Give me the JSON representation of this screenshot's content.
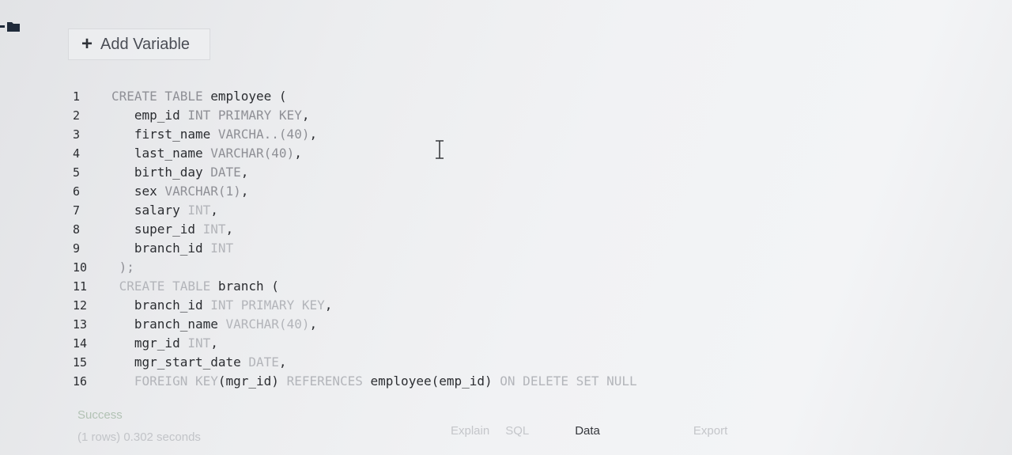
{
  "toolbar": {
    "add_variable_label": "Add Variable"
  },
  "editor": {
    "line_numbers": [
      "1",
      "2",
      "3",
      "4",
      "5",
      "6",
      "7",
      "8",
      "9",
      "10",
      "11",
      "12",
      "13",
      "14",
      "15",
      "16"
    ],
    "lines": [
      [
        {
          "t": "CREATE TABLE",
          "c": "kw"
        },
        {
          "t": " employee (",
          "c": "ident"
        }
      ],
      [
        {
          "t": "   emp_id ",
          "c": "ident"
        },
        {
          "t": "INT PRIMARY KEY",
          "c": "kw"
        },
        {
          "t": ",",
          "c": "punct"
        }
      ],
      [
        {
          "t": "   first_name ",
          "c": "ident"
        },
        {
          "t": "VARCHA..(40)",
          "c": "kw"
        },
        {
          "t": ",",
          "c": "punct"
        }
      ],
      [
        {
          "t": "   last_name ",
          "c": "ident"
        },
        {
          "t": "VARCHAR(40)",
          "c": "kw"
        },
        {
          "t": ",",
          "c": "punct"
        }
      ],
      [
        {
          "t": "   birth_day ",
          "c": "ident"
        },
        {
          "t": "DATE",
          "c": "kw"
        },
        {
          "t": ",",
          "c": "punct"
        }
      ],
      [
        {
          "t": "   sex ",
          "c": "ident"
        },
        {
          "t": "VARCHAR(1)",
          "c": "kw"
        },
        {
          "t": ",",
          "c": "punct"
        }
      ],
      [
        {
          "t": "   salary ",
          "c": "ident"
        },
        {
          "t": "INT",
          "c": "kw-faint"
        },
        {
          "t": ",",
          "c": "punct"
        }
      ],
      [
        {
          "t": "   super_id ",
          "c": "ident"
        },
        {
          "t": "INT",
          "c": "kw-faint"
        },
        {
          "t": ",",
          "c": "punct"
        }
      ],
      [
        {
          "t": "   branch_id ",
          "c": "ident"
        },
        {
          "t": "INT",
          "c": "kw-faint"
        }
      ],
      [
        {
          "t": " );",
          "c": "kw"
        }
      ],
      [
        {
          "t": " CREATE TABLE",
          "c": "kw-faint"
        },
        {
          "t": " branch (",
          "c": "ident"
        }
      ],
      [
        {
          "t": "   branch_id ",
          "c": "ident"
        },
        {
          "t": "INT PRIMARY KEY",
          "c": "kw-faint"
        },
        {
          "t": ",",
          "c": "punct"
        }
      ],
      [
        {
          "t": "   branch_name ",
          "c": "ident"
        },
        {
          "t": "VARCHAR(40)",
          "c": "kw-faint"
        },
        {
          "t": ",",
          "c": "punct"
        }
      ],
      [
        {
          "t": "   mgr_id ",
          "c": "ident"
        },
        {
          "t": "INT",
          "c": "kw-faint"
        },
        {
          "t": ",",
          "c": "punct"
        }
      ],
      [
        {
          "t": "   mgr_start_date ",
          "c": "ident"
        },
        {
          "t": "DATE",
          "c": "kw-faint"
        },
        {
          "t": ",",
          "c": "punct"
        }
      ],
      [
        {
          "t": "   FOREIGN KEY",
          "c": "kw-faint"
        },
        {
          "t": "(mgr_id) ",
          "c": "ident"
        },
        {
          "t": "REFERENCES",
          "c": "kw-faint"
        },
        {
          "t": " employee(emp_id) ",
          "c": "ident"
        },
        {
          "t": "ON DELETE SET NULL",
          "c": "kw-faint"
        }
      ]
    ]
  },
  "status": {
    "result": "Success",
    "meta": "(1 rows) 0.302 seconds"
  },
  "result_tabs": {
    "explain": "Explain",
    "sql": "SQL",
    "data": "Data",
    "export": "Export"
  },
  "icons": {
    "corner": "folder-icon",
    "cursor": "text-cursor-icon"
  }
}
